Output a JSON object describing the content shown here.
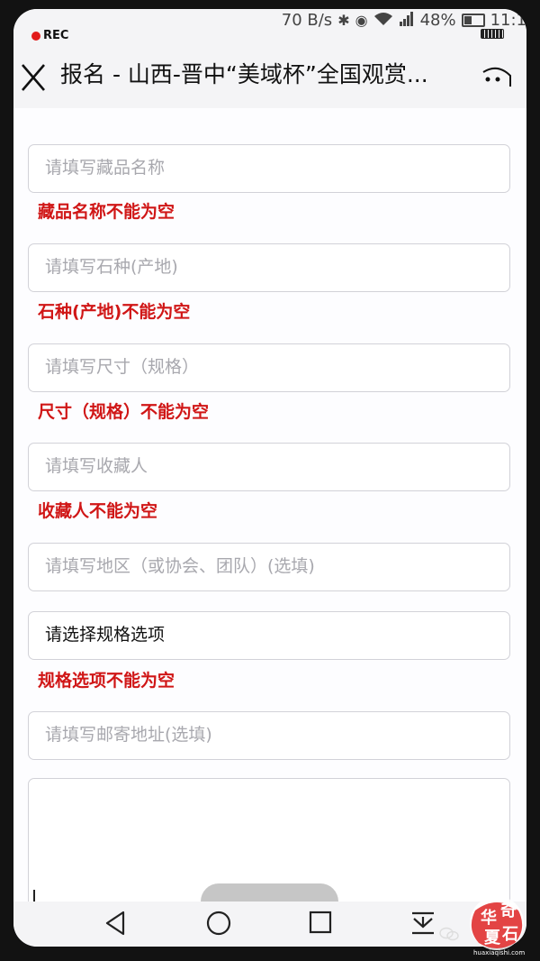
{
  "status_bar": {
    "rec_label": "REC",
    "network_speed": "70 B/s",
    "battery_percent": "48%",
    "time": "11:1",
    "battery_level": 0.48
  },
  "header": {
    "title": "报名 - 山西-晋中“美域杯”全国观赏..."
  },
  "form": {
    "collection_name": {
      "placeholder": "请填写藏品名称",
      "error": "藏品名称不能为空"
    },
    "stone_type": {
      "placeholder": "请填写石种(产地)",
      "error": "石种(产地)不能为空"
    },
    "size": {
      "placeholder": "请填写尺寸（规格）",
      "error": "尺寸（规格）不能为空"
    },
    "collector": {
      "placeholder": "请填写收藏人",
      "error": "收藏人不能为空"
    },
    "region": {
      "placeholder": "请填写地区（或协会、团队）(选填)"
    },
    "spec_option": {
      "value": "请选择规格选项",
      "error": "规格选项不能为空"
    },
    "mail_address": {
      "placeholder": "请填写邮寄地址(选填)"
    },
    "notes": {
      "placeholder": ""
    }
  },
  "watermark": {
    "text": "华夏奇石",
    "url_text": "huaxiaqishi.com"
  },
  "colors": {
    "error": "#d01616",
    "placeholder": "#a8a8ae",
    "border": "#d2d2d8"
  }
}
